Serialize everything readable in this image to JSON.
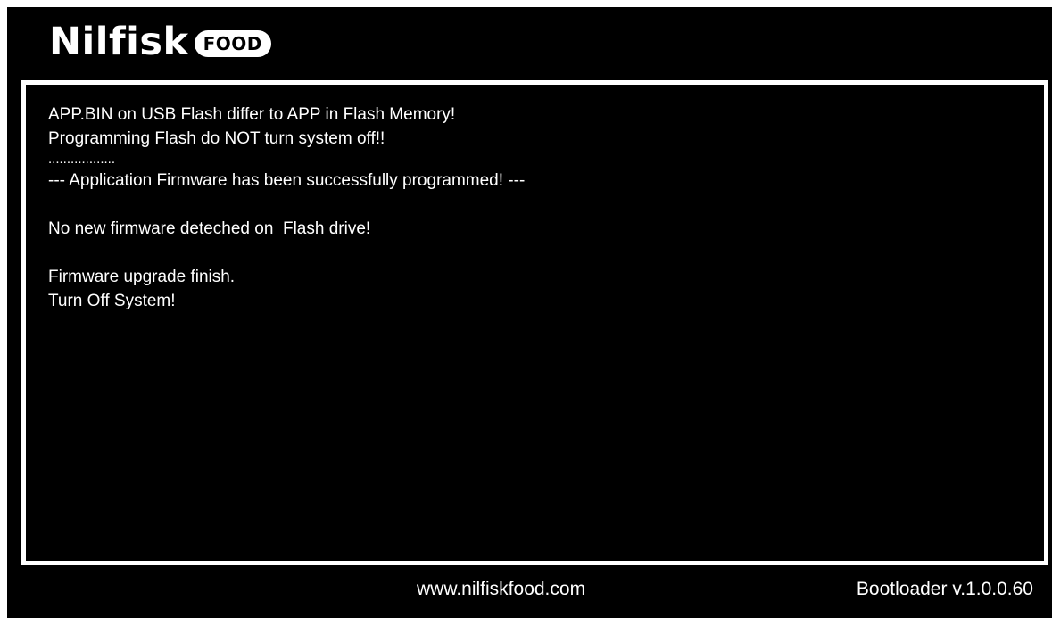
{
  "brand": {
    "name": "Nilfisk",
    "badge": "FOOD"
  },
  "console": {
    "lines": [
      "APP.BIN on USB Flash differ to APP in Flash Memory!",
      "Programming Flash do NOT turn system off!!",
      "..................",
      "--- Application Firmware has been successfully programmed! ---",
      "",
      "No new firmware deteched on  Flash drive!",
      "",
      "Firmware upgrade finish.",
      "Turn Off System!"
    ]
  },
  "footer": {
    "url": "www.nilfiskfood.com",
    "version": "Bootloader v.1.0.0.60"
  },
  "colors": {
    "background": "#000000",
    "text": "#ffffff",
    "frame": "#ffffff"
  }
}
